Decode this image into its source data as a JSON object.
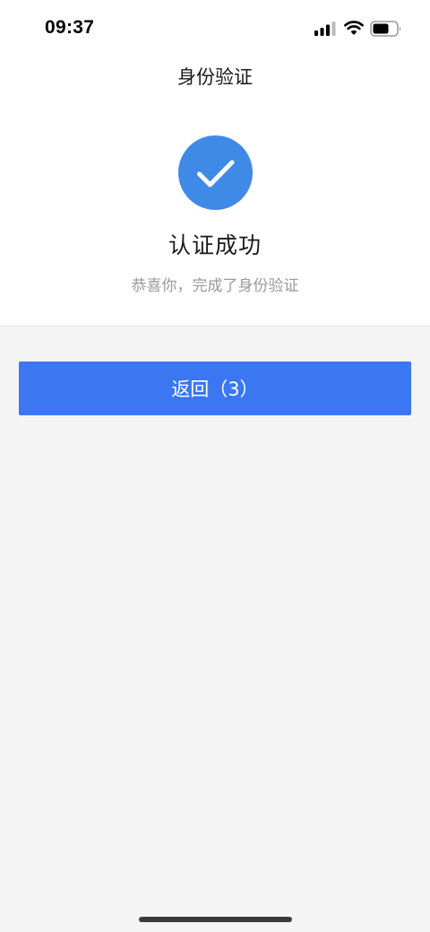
{
  "status_bar": {
    "time": "09:37",
    "icons": [
      "cellular-signal-icon",
      "wifi-icon",
      "battery-icon"
    ]
  },
  "header": {
    "title": "身份验证"
  },
  "result": {
    "icon": "checkmark-icon",
    "title": "认证成功",
    "subtitle": "恭喜你，完成了身份验证"
  },
  "actions": {
    "back_label": "返回（3）"
  },
  "colors": {
    "accent": "#3a77f0",
    "success_circle": "#3f8ae6",
    "background": "#f4f4f4",
    "subtitle": "#9a9a9a"
  }
}
